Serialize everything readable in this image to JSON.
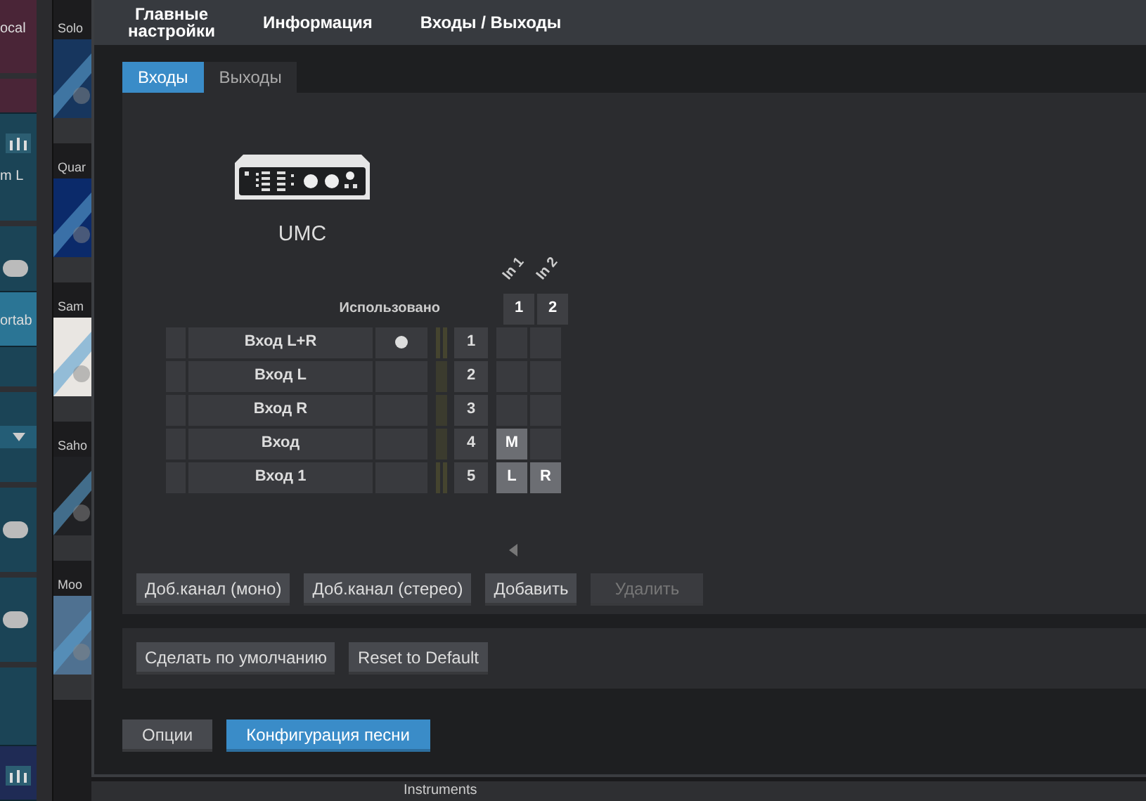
{
  "backdrop": {
    "tracks": [
      {
        "color": "#4a2537",
        "items": [
          {
            "kind": "label",
            "text": "ocal"
          },
          {
            "kind": "rule"
          }
        ]
      },
      {
        "color": "#1b4456",
        "items": [
          {
            "kind": "meter"
          },
          {
            "kind": "label",
            "text": "m L"
          },
          {
            "kind": "rule"
          },
          {
            "kind": "toggle"
          }
        ]
      },
      {
        "color": "#2b7595",
        "items": [
          {
            "kind": "label",
            "text": "ortab"
          }
        ]
      },
      {
        "color": "#1b4456",
        "items": [
          {
            "kind": "rule"
          },
          {
            "kind": "dropdown"
          },
          {
            "kind": "rule"
          },
          {
            "kind": "toggle"
          },
          {
            "kind": "rule"
          },
          {
            "kind": "toggle"
          },
          {
            "kind": "rule"
          }
        ]
      },
      {
        "color": "#1f2b55",
        "items": [
          {
            "kind": "meter"
          }
        ]
      }
    ],
    "browser": [
      {
        "label": "Solo",
        "color": "#17365e"
      },
      {
        "label": "Quar",
        "color": "#0b2a6a"
      },
      {
        "label": "Sam",
        "color": "#e9e6e2"
      },
      {
        "label": "Saho",
        "color": "#202124"
      },
      {
        "label": "Moo",
        "color": "#4f7191"
      }
    ],
    "bottom_label": "Instruments"
  },
  "dialog": {
    "tabs": [
      {
        "label": "Главные настройки",
        "selected": false
      },
      {
        "label": "Информация",
        "selected": false
      },
      {
        "label": "Входы / Выходы",
        "selected": false
      }
    ],
    "io_tabs": [
      {
        "label": "Входы",
        "selected": true
      },
      {
        "label": "Выходы",
        "selected": false
      }
    ],
    "device": {
      "name": "UMC"
    },
    "matrix": {
      "used_header": "Использовано",
      "inputs": [
        {
          "label": "In 1",
          "number": "1"
        },
        {
          "label": "In 2",
          "number": "2"
        }
      ],
      "channels": [
        {
          "name": "Вход L+R",
          "used": true,
          "number": "1",
          "kind": "stereo",
          "cells": [
            {
              "lit": false
            },
            {
              "lit": false
            }
          ]
        },
        {
          "name": "Вход L",
          "used": false,
          "number": "2",
          "kind": "mono",
          "cells": [
            {
              "lit": false
            },
            {
              "lit": false
            }
          ]
        },
        {
          "name": "Вход R",
          "used": false,
          "number": "3",
          "kind": "mono",
          "cells": [
            {
              "lit": false
            },
            {
              "lit": false
            }
          ]
        },
        {
          "name": "Вход",
          "used": false,
          "number": "4",
          "kind": "mono",
          "cells": [
            {
              "lit": true,
              "text": "M"
            },
            {
              "lit": false
            }
          ]
        },
        {
          "name": "Вход 1",
          "used": false,
          "number": "5",
          "kind": "stereo",
          "cells": [
            {
              "lit": true,
              "text": "L"
            },
            {
              "lit": true,
              "text": "R"
            }
          ]
        }
      ]
    },
    "channel_buttons": [
      {
        "label": "Доб.канал (моно)",
        "disabled": false
      },
      {
        "label": "Доб.канал (стерео)",
        "disabled": false
      },
      {
        "label": "Добавить",
        "disabled": false
      },
      {
        "label": "Удалить",
        "disabled": true
      }
    ],
    "default_buttons": [
      {
        "label": "Сделать по умолчанию"
      },
      {
        "label": "Reset to Default"
      }
    ],
    "footer_buttons": [
      {
        "label": "Опции",
        "primary": false
      },
      {
        "label": "Конфигурация песни",
        "primary": true
      }
    ]
  }
}
